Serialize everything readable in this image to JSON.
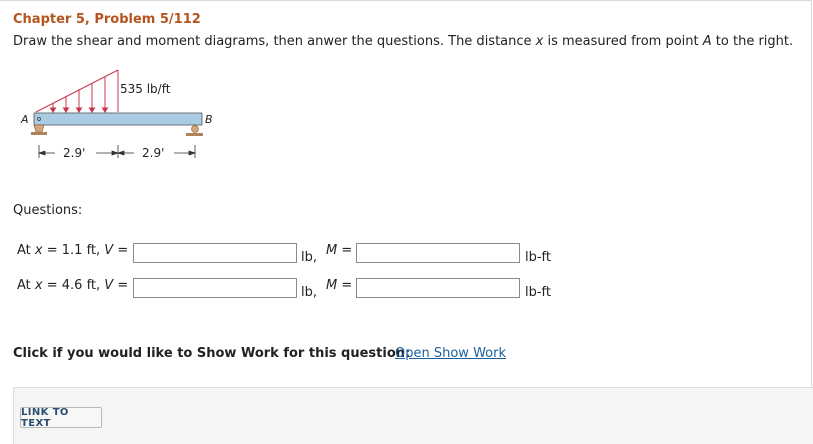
{
  "header": {
    "title": "Chapter 5, Problem 5/112",
    "statement_before_x": "Draw the shear and moment diagrams, then anwer the questions. The distance ",
    "var_x": "x",
    "statement_mid": " is measured from point ",
    "var_A": "A",
    "statement_end": " to the right."
  },
  "figure": {
    "load_label": "535 lb/ft",
    "point_A": "A",
    "point_B": "B",
    "dim_left": "2.9'",
    "dim_right": "2.9'",
    "colors": {
      "load": "#c8374a",
      "beam": "#a9cce3",
      "support": "#d4a57a"
    }
  },
  "questions": {
    "label": "Questions:",
    "rows": [
      {
        "prefix": "At ",
        "x_var": "x",
        "mid": " = 1.1 ft, ",
        "v_var": "V",
        "eq": " =",
        "v_unit": "lb,",
        "m_var": "M",
        "m_eq": " =",
        "m_unit": "lb-ft",
        "v_value": "",
        "m_value": ""
      },
      {
        "prefix": "At ",
        "x_var": "x",
        "mid": " = 4.6 ft, ",
        "v_var": "V",
        "eq": " =",
        "v_unit": "lb,",
        "m_var": "M",
        "m_eq": " =",
        "m_unit": "lb-ft",
        "v_value": "",
        "m_value": ""
      }
    ]
  },
  "show_work": {
    "prompt": "Click if you would like to Show Work for this question:",
    "link": "Open Show Work"
  },
  "footer": {
    "link_to_text": "LINK TO TEXT"
  }
}
